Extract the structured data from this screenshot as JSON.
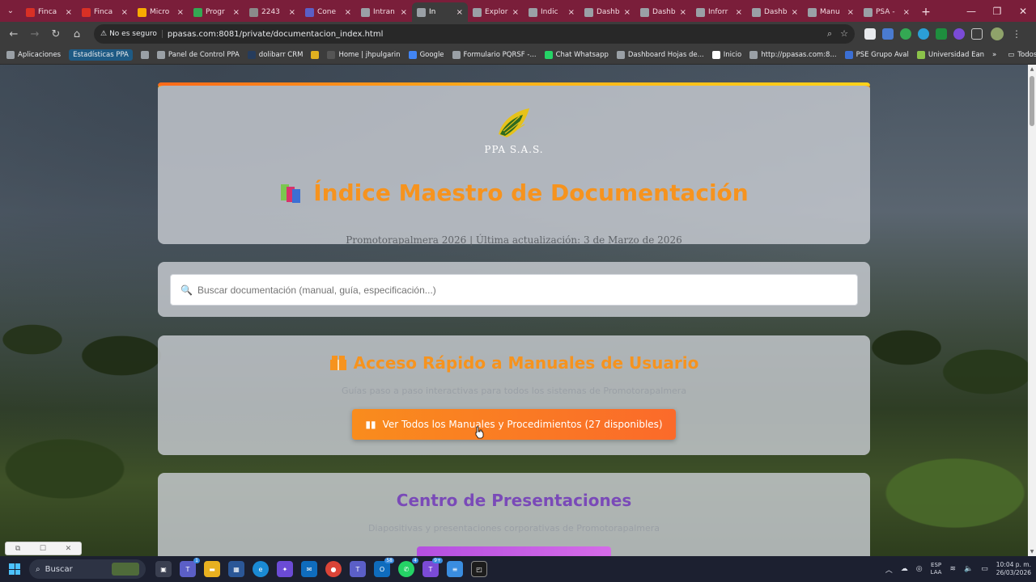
{
  "browser": {
    "tabs": [
      {
        "label": "Finca",
        "favicon_color": "#d93025",
        "active": false
      },
      {
        "label": "Finca",
        "favicon_color": "#d93025",
        "active": false
      },
      {
        "label": "Micro",
        "favicon_color": "#f9ab00",
        "active": false
      },
      {
        "label": "Progr",
        "favicon_color": "#34a853",
        "active": false
      },
      {
        "label": "2243",
        "favicon_color": "#8a8a8a",
        "active": false
      },
      {
        "label": "Cone",
        "favicon_color": "#5b5fc7",
        "active": false
      },
      {
        "label": "Intran",
        "favicon_color": "#9aa0a6",
        "active": false
      },
      {
        "label": "Ín",
        "favicon_color": "#9aa0a6",
        "active": true
      },
      {
        "label": "Explor",
        "favicon_color": "#9aa0a6",
        "active": false
      },
      {
        "label": "Indic",
        "favicon_color": "#9aa0a6",
        "active": false
      },
      {
        "label": "Dashb",
        "favicon_color": "#9aa0a6",
        "active": false
      },
      {
        "label": "Dashb",
        "favicon_color": "#9aa0a6",
        "active": false
      },
      {
        "label": "Inforr",
        "favicon_color": "#9aa0a6",
        "active": false
      },
      {
        "label": "Dashb",
        "favicon_color": "#9aa0a6",
        "active": false
      },
      {
        "label": "Manu",
        "favicon_color": "#9aa0a6",
        "active": false
      },
      {
        "label": "PSA -",
        "favicon_color": "#9aa0a6",
        "active": false
      }
    ],
    "tab_close_glyph": "×",
    "new_tab_glyph": "+",
    "security_label": "No es seguro",
    "url": "ppasas.com:8081/private/documentacion_index.html",
    "bookmarks": [
      {
        "label": "Aplicaciones",
        "icon_color": "#9aa0a6",
        "pill": false
      },
      {
        "label": "Estadísticas PPA",
        "icon_color": "",
        "pill": true
      },
      {
        "label": "",
        "icon_color": "#9aa0a6",
        "pill": false
      },
      {
        "label": "Panel de Control PPA",
        "icon_color": "#9aa0a6",
        "pill": false
      },
      {
        "label": "dolibarr CRM",
        "icon_color": "#263c5c",
        "pill": false
      },
      {
        "label": "",
        "icon_color": "#e0b020",
        "pill": false
      },
      {
        "label": "Home | jhpulgarin",
        "icon_color": "#555555",
        "pill": false
      },
      {
        "label": "Google",
        "icon_color": "#4285f4",
        "pill": false
      },
      {
        "label": "Formulario PQRSF -...",
        "icon_color": "#9aa0a6",
        "pill": false
      },
      {
        "label": "Chat Whatsapp",
        "icon_color": "#25d366",
        "pill": false
      },
      {
        "label": "Dashboard Hojas de...",
        "icon_color": "#9aa0a6",
        "pill": false
      },
      {
        "label": "Inicio",
        "icon_color": "#ffffff",
        "pill": false
      },
      {
        "label": "http://ppasas.com:8...",
        "icon_color": "#9aa0a6",
        "pill": false
      },
      {
        "label": "PSE Grupo Aval",
        "icon_color": "#3b6fd4",
        "pill": false
      },
      {
        "label": "Universidad Ean",
        "icon_color": "#8bc34a",
        "pill": false
      }
    ],
    "all_bookmarks_label": "Todos los marcadores"
  },
  "page": {
    "logo_text": "PPA S.A.S.",
    "title": "Índice Maestro de Documentación",
    "subtitle": "Promotorapalmera 2026 | Última actualización: 3 de Marzo de 2026",
    "search_placeholder": "Buscar documentación (manual, guía, especificación...)",
    "manuals": {
      "title": "Acceso Rápido a Manuales de Usuario",
      "description": "Guías paso a paso interactivas para todos los sistemas de Promotorapalmera",
      "button_label": "Ver Todos los Manuales y Procedimientos (27 disponibles)"
    },
    "presentations": {
      "title": "Centro de Presentaciones",
      "description": "Diapositivas y presentaciones corporativas de Promotorapalmera"
    }
  },
  "taskbar": {
    "search_label": "Buscar",
    "language_top": "ESP",
    "language_bottom": "LAA",
    "time": "10:04 p. m.",
    "date": "26/03/2026",
    "badges": {
      "teams": "1",
      "outlook": "58",
      "whatsapp": "4",
      "teams2": "9+"
    }
  },
  "colors": {
    "tabstrip": "#7a1e3a",
    "accent_orange": "#f6931e",
    "accent_purple": "#7a4ab8"
  }
}
